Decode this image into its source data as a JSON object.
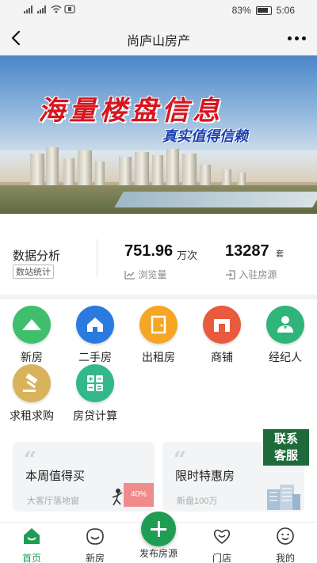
{
  "status_bar": {
    "battery": "83%",
    "time": "5:06"
  },
  "navbar": {
    "title": "尚庐山房产"
  },
  "banner": {
    "headline": "海量楼盘信息",
    "subheadline": "真实值得信赖"
  },
  "stats": {
    "title": "数据分析",
    "badge": "数站统计",
    "views_value": "751.96",
    "views_unit": "万次",
    "views_label": "浏览量",
    "listings_value": "13287",
    "listings_unit": "套",
    "listings_label": "入驻房源"
  },
  "grid": [
    {
      "label": "新房",
      "icon": "mountain-icon",
      "color": "#3fbf6e"
    },
    {
      "label": "二手房",
      "icon": "home-icon",
      "color": "#2b7ae0"
    },
    {
      "label": "出租房",
      "icon": "door-icon",
      "color": "#f6a623"
    },
    {
      "label": "商铺",
      "icon": "shop-icon",
      "color": "#e85b3f"
    },
    {
      "label": "经纪人",
      "icon": "agent-icon",
      "color": "#2fb57a"
    },
    {
      "label": "求租求购",
      "icon": "gavel-icon",
      "color": "#d9b25c"
    },
    {
      "label": "房贷计算",
      "icon": "calculator-icon",
      "color": "#33b889"
    }
  ],
  "cards": [
    {
      "title": "本周值得买",
      "subtitle": "大客厅落地窗",
      "tag": "40%"
    },
    {
      "title": "限时特惠房",
      "subtitle": "新盘100万"
    }
  ],
  "service_badge": {
    "line1": "联系",
    "line2": "客服"
  },
  "tabbar": {
    "items": [
      {
        "label": "首页",
        "icon": "home-smile-icon"
      },
      {
        "label": "新房",
        "icon": "smile-icon"
      },
      {
        "label": "发布房源",
        "icon": "plus-icon"
      },
      {
        "label": "门店",
        "icon": "heart-icon"
      },
      {
        "label": "我的",
        "icon": "face-icon"
      }
    ],
    "active": "首页",
    "active_color": "#1f9d55"
  }
}
